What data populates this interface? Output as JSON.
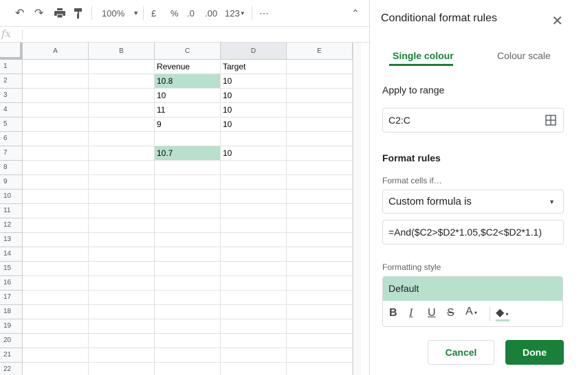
{
  "toolbar": {
    "zoom": "100%",
    "currency": "£",
    "percent": "%",
    "dec_decrease": ".0",
    "dec_increase": ".00",
    "format_more": "123"
  },
  "formula_bar": {
    "fx": "fx",
    "value": ""
  },
  "columns": [
    "A",
    "B",
    "C",
    "D",
    "E"
  ],
  "rows": [
    "1",
    "2",
    "3",
    "4",
    "5",
    "6",
    "7",
    "8",
    "9",
    "10",
    "11",
    "12",
    "13",
    "14",
    "15",
    "16",
    "17",
    "18",
    "19",
    "20",
    "21",
    "22"
  ],
  "cells": {
    "C1": "Revenue",
    "D1": "Target",
    "C2": "10.8",
    "D2": "10",
    "C3": "10",
    "D3": "10",
    "C4": "11",
    "D4": "10",
    "C5": "9",
    "D5": "10",
    "C7": "10.7",
    "D7": "10"
  },
  "highlight_color": "#b7e1cd",
  "panel": {
    "title": "Conditional format rules",
    "tabs": [
      "Single colour",
      "Colour scale"
    ],
    "apply_label": "Apply to range",
    "range": "C2:C",
    "format_rules": "Format rules",
    "format_cells_if": "Format cells if…",
    "condition": "Custom formula is",
    "formula": "=And($C2>$D2*1.05,$C2<$D2*1.1)",
    "formatting_style": "Formatting style",
    "style_preview": "Default",
    "style_buttons": {
      "bold": "B",
      "italic": "I",
      "underline": "U",
      "strike": "S",
      "text_color": "A"
    },
    "cancel": "Cancel",
    "done": "Done",
    "accent": "#188038"
  }
}
